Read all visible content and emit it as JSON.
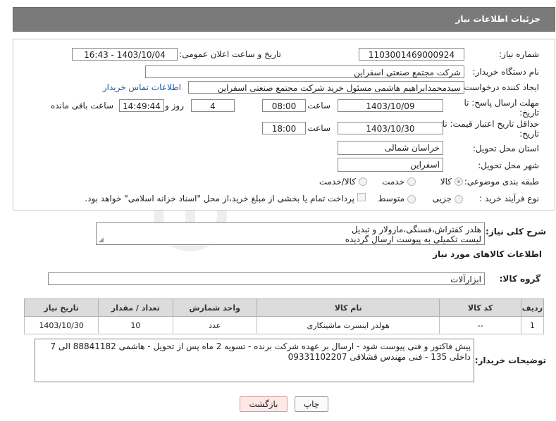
{
  "header": {
    "title": "جزئیات اطلاعات نیاز"
  },
  "form": {
    "need_number_label": "شماره نیاز:",
    "need_number": "1103001469000924",
    "announce_label": "تاریخ و ساعت اعلان عمومی:",
    "announce_value": "1403/10/04 - 16:43",
    "buyer_org_label": "نام دستگاه خریدار:",
    "buyer_org": "شرکت مجتمع صنعتی اسفراین",
    "requester_label": "ایجاد کننده درخواست:",
    "requester": "سیدمحمدابراهیم هاشمی مسئول خرید شرکت مجتمع صنعتی اسفراین",
    "contact_link": "اطلاعات تماس خریدار",
    "reply_deadline_label_1": "مهلت ارسال پاسخ: تا",
    "reply_deadline_label_2": "تاریخ:",
    "reply_date": "1403/10/09",
    "time_label": "ساعت",
    "reply_time": "08:00",
    "days_value": "4",
    "days_label": "روز و",
    "remaining_time": "14:49:44",
    "remaining_label": "ساعت باقی مانده",
    "price_validity_label_1": "حداقل تاریخ اعتبار قیمت: تا",
    "price_validity_label_2": "تاریخ:",
    "validity_date": "1403/10/30",
    "validity_time": "18:00",
    "province_label": "استان محل تحویل:",
    "province": "خراسان شمالی",
    "city_label": "شهر محل تحویل:",
    "city": "اسفراین",
    "category_label": "طبقه بندی موضوعی:",
    "category_options": [
      "کالا",
      "خدمت",
      "کالا/خدمت"
    ],
    "process_label": "نوع فرآیند خرید :",
    "process_options": [
      "جزیی",
      "متوسط"
    ],
    "process_note": "پرداخت تمام یا بخشی از مبلغ خرید،از محل \"اسناد خزانه اسلامی\" خواهد بود."
  },
  "description": {
    "label": "شرح کلی نیاز:",
    "line1": "هلدر کفتراش،فسنگی،مازولار و تبدیل",
    "line2": "لیست تکمیلی به پیوست ارسال گردیده"
  },
  "goods": {
    "section_title": "اطلاعات کالاهای مورد نیاز",
    "group_label": "گروه کالا:",
    "group_value": "ابزارآلات",
    "columns": [
      "ردیف",
      "کد کالا",
      "نام کالا",
      "واحد شمارش",
      "تعداد / مقدار",
      "تاریخ نیاز"
    ],
    "rows": [
      [
        "1",
        "--",
        "هولدر اینسرت ماشینکاری",
        "عدد",
        "10",
        "1403/10/30"
      ]
    ]
  },
  "buyer_notes": {
    "label": "توضیحات خریدار:",
    "line1": "پیش فاکتور و فنی پیوست شود - ارسال بر عهده شرکت برنده - تسویه 2 ماه پس از تحویل - هاشمی 88841182 الی 7",
    "line2": "داخلی 135 - فنی مهندس قشلاقی 09331102207"
  },
  "buttons": {
    "print": "چاپ",
    "back": "بازگشت"
  }
}
